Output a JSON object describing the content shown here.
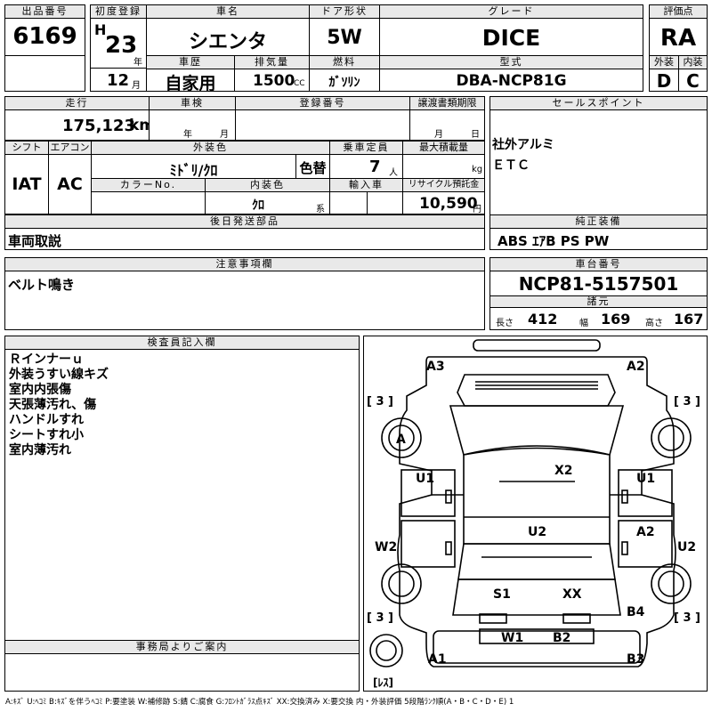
{
  "header": {
    "lot_no_label": "出品番号",
    "lot_no": "6169",
    "first_reg_label": "初度登録",
    "era": "H",
    "year": "23",
    "year_unit": "年",
    "month": "12",
    "month_unit": "月",
    "car_name_label": "車名",
    "car_name": "シエンタ",
    "doors_label": "ドア形状",
    "doors": "5W",
    "grade_label": "グレード",
    "grade": "DICE",
    "score_label": "評価点",
    "score": "RA",
    "history_label": "車歴",
    "history": "自家用",
    "displacement_label": "排気量",
    "displacement": "1500",
    "displacement_unit": "CC",
    "fuel_label": "燃料",
    "fuel": "ｶﾞｿﾘﾝ",
    "model_label": "型式",
    "model": "DBA-NCP81G",
    "exterior_label": "外装",
    "exterior": "D",
    "interior_label": "内装",
    "interior": "C"
  },
  "row2": {
    "mileage_label": "走行",
    "mileage": "175,123",
    "mileage_unit": "km",
    "inspection_label": "車検",
    "inspection_year_unit": "年",
    "inspection_month_unit": "月",
    "reg_no_label": "登録番号",
    "transfer_label": "譲渡書類期限",
    "transfer_month_unit": "月",
    "transfer_day_unit": "日",
    "sales_label": "セールスポイント",
    "sales_points": [
      "社外アルミ",
      "ＥＴＣ"
    ]
  },
  "row3": {
    "shift_label": "シフト",
    "shift": "IAT",
    "ac_label": "エアコン",
    "ac": "AC",
    "ext_color_label": "外装色",
    "ext_color": "ﾐﾄﾞﾘ/ｸﾛ",
    "color_change": "色替",
    "capacity_label": "乗車定員",
    "capacity": "7",
    "capacity_unit": "人",
    "load_label": "最大積載量",
    "load_unit": "kg",
    "color_no_label": "カラーNo.",
    "int_color_label": "内装色",
    "int_color": "ｸﾛ",
    "int_color_unit": "系",
    "import_label": "輸入車",
    "recycle_label": "リサイクル預託金",
    "recycle": "10,590",
    "recycle_unit": "円"
  },
  "later_parts": {
    "label": "後日発送部品",
    "value": "車両取説"
  },
  "equipment": {
    "label": "純正装備",
    "value": "ABS ｴｱB PS PW"
  },
  "notes": {
    "label": "注意事項欄",
    "value": "ベルト鳴き"
  },
  "chassis": {
    "label": "車台番号",
    "value": "NCP81-5157501",
    "spec_label": "諸元",
    "length_label": "長さ",
    "length": "412",
    "width_label": "幅",
    "width": "169",
    "height_label": "高さ",
    "height": "167"
  },
  "inspector": {
    "label": "検査員記入欄",
    "remarks": [
      "Ｒインナーｕ",
      "外装うすい線キズ",
      "室内内張傷",
      "天張薄汚れ、傷",
      "ハンドルすれ",
      "シートすれ小",
      "室内薄汚れ"
    ]
  },
  "office": {
    "label": "事務局よりご案内"
  },
  "diagram": {
    "tire_bracket": "[ 3 ]",
    "less": "[ﾚｽ]",
    "marks": {
      "a3": "A3",
      "a2_top": "A2",
      "a_left": "A",
      "u1_left": "U1",
      "x2": "X2",
      "u1_right": "U1",
      "w2": "W2",
      "u2_center": "U2",
      "a2_right": "A2",
      "u2_right": "U2",
      "s1": "S1",
      "xx": "XX",
      "b4": "B4",
      "w1": "W1",
      "b2": "B2",
      "a1": "A1",
      "b3": "B3"
    }
  },
  "legend": "A:ｷｽﾞ U:ﾍｺﾐ B:ｷｽﾞを伴うﾍｺﾐ P:要塗装 W:補修跡 S:錆 C:腐食 G:ﾌﾛﾝﾄｶﾞﾗｽ点ｷｽﾞ XX:交換済み X:要交換 内・外装評価 5段階ﾗﾝｸ順(A・B・C・D・E) 1"
}
